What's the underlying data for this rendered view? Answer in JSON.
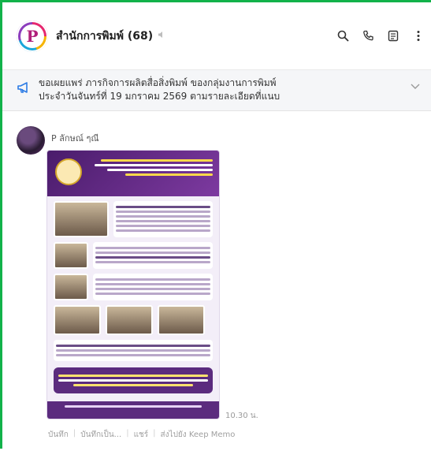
{
  "header": {
    "group_title": "สำนักการพิมพ์ (68)",
    "avatar_letter": "P",
    "icons": [
      "search-icon",
      "phone-icon",
      "notes-icon",
      "more-vertical-icon"
    ]
  },
  "announcement": {
    "line1": "ขอเผยแพร่ ภารกิจการผลิตสื่อสิ่งพิมพ์ ของกลุ่มงานการพิมพ์",
    "line2": "ประจำวันจันทร์ที่ 19 มกราคม 2569 ตามรายละเอียดที่แนบ"
  },
  "message": {
    "sender": "P ลักษณ์ ๆณี",
    "time": "10.30 น.",
    "actions": [
      "บันทึก",
      "บันทึกเป็น...",
      "แชร์",
      "ส่งไปยัง Keep Memo"
    ]
  },
  "colors": {
    "frame_green": "#12b24a",
    "accent_blue": "#2c7be5",
    "poster_purple": "#5b2b7e"
  }
}
